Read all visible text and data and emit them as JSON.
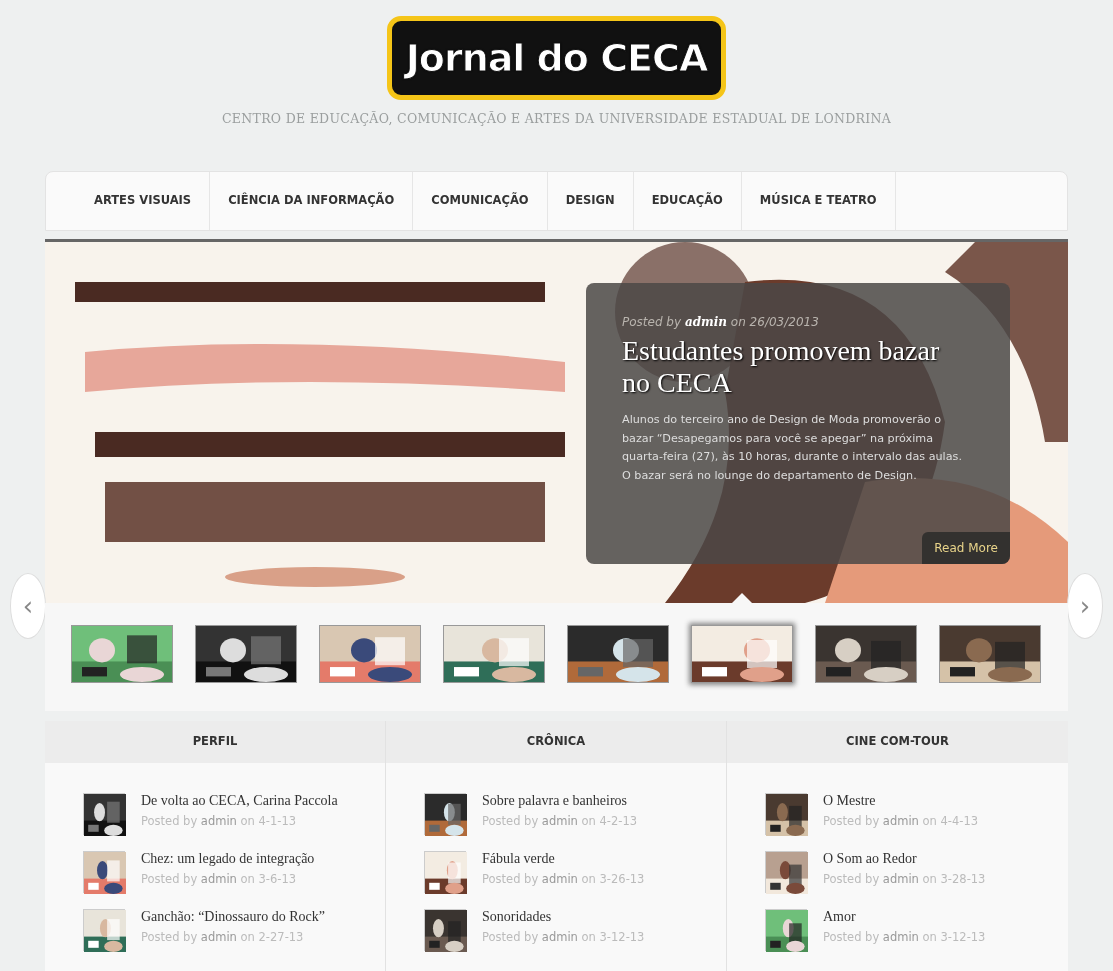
{
  "header": {
    "logo": "Jornal do CECA",
    "tagline": "CENTRO DE EDUCAÇÃO, COMUNICAÇÃO E ARTES DA UNIVERSIDADE ESTADUAL DE LONDRINA"
  },
  "nav": {
    "items": [
      "ARTES VISUAIS",
      "CIÊNCIA DA INFORMAÇÃO",
      "COMUNICAÇÃO",
      "DESIGN",
      "EDUCAÇÃO",
      "MÚSICA E TEATRO"
    ]
  },
  "slider": {
    "prev": "‹",
    "next": "›",
    "caption": {
      "posted_by": "Posted by",
      "author": "admin",
      "date": "on 26/03/2013",
      "title": "Estudantes promovem bazar no CECA",
      "excerpt": "Alunos do terceiro ano de Design de Moda promoverão o bazar “Desapegamos para você se apegar” na próxima quarta-feira (27), às 10 horas, durante o intervalo das aulas. O bazar será no lounge do departamento de Design.",
      "button": "Read More"
    },
    "thumbnails": [
      {
        "kind": "picture",
        "selected": false
      },
      {
        "kind": "picture",
        "selected": false
      },
      {
        "kind": "picture",
        "selected": false
      },
      {
        "kind": "picture",
        "selected": false
      },
      {
        "kind": "picture",
        "selected": false
      },
      {
        "kind": "picture",
        "selected": true
      },
      {
        "kind": "picture",
        "selected": false
      },
      {
        "kind": "picture",
        "selected": false
      }
    ]
  },
  "columns": [
    {
      "title": "PERFIL",
      "posts": [
        {
          "title": "De volta ao CECA, Carina Paccola",
          "by": "Posted by",
          "author": "admin",
          "date": "on 4-1-13"
        },
        {
          "title": "Chez: um legado de integração",
          "by": "Posted by",
          "author": "admin",
          "date": "on 3-6-13"
        },
        {
          "title": "Ganchão: “Dinossauro do Rock”",
          "by": "Posted by",
          "author": "admin",
          "date": "on 2-27-13"
        }
      ]
    },
    {
      "title": "CRÔNICA",
      "posts": [
        {
          "title": "Sobre palavra e banheiros",
          "by": "Posted by",
          "author": "admin",
          "date": "on 4-2-13"
        },
        {
          "title": "Fábula verde",
          "by": "Posted by",
          "author": "admin",
          "date": "on 3-26-13"
        },
        {
          "title": "Sonoridades",
          "by": "Posted by",
          "author": "admin",
          "date": "on 3-12-13"
        }
      ]
    },
    {
      "title": "CINE COM-TOUR",
      "posts": [
        {
          "title": "O Mestre",
          "by": "Posted by",
          "author": "admin",
          "date": "on 4-4-13"
        },
        {
          "title": "O Som ao Redor",
          "by": "Posted by",
          "author": "admin",
          "date": "on 3-28-13"
        },
        {
          "title": "Amor",
          "by": "Posted by",
          "author": "admin",
          "date": "on 3-12-13"
        }
      ]
    }
  ]
}
